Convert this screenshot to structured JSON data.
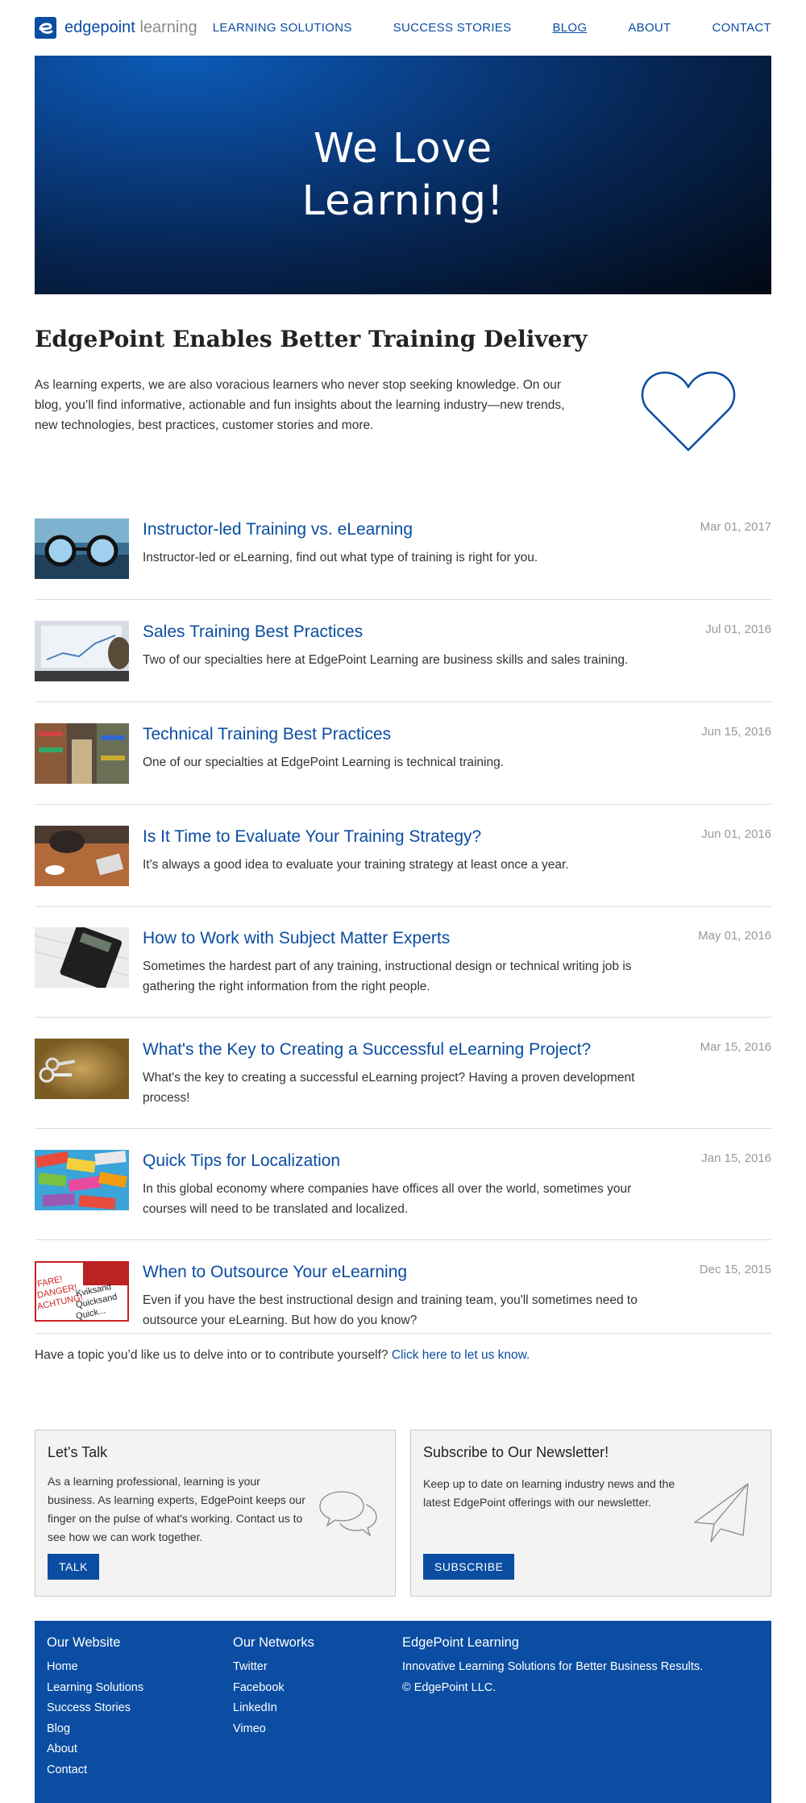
{
  "header": {
    "logo_brand": "edgepoint",
    "logo_suffix": "learning",
    "nav": [
      {
        "label": "LEARNING SOLUTIONS"
      },
      {
        "label": "SUCCESS STORIES"
      },
      {
        "label": "BLOG"
      },
      {
        "label": "ABOUT"
      },
      {
        "label": "CONTACT"
      }
    ]
  },
  "hero": {
    "title": "We Love\nLearning!"
  },
  "intro": {
    "heading": "EdgePoint Enables Better Training Delivery",
    "text": "As learning experts, we are also voracious learners who never stop seeking knowledge. On our blog, you’ll find informative, actionable and fun insights about the learning industry—new trends, new technologies, best practices, customer stories and more.",
    "icon": "heart-icon"
  },
  "posts": [
    {
      "title": "Instructor-led Training vs. eLearning",
      "desc": "Instructor-led or eLearning, find out what type of training is right for you.",
      "date": "Mar 01, 2017"
    },
    {
      "title": "Sales Training Best Practices",
      "desc": "Two of our specialties here at EdgePoint Learning are business skills and sales training.",
      "date": "Jul 01, 2016"
    },
    {
      "title": "Technical Training Best Practices",
      "desc": "One of our specialties at EdgePoint Learning is technical training.",
      "date": "Jun 15, 2016"
    },
    {
      "title": "Is It Time to Evaluate Your Training Strategy?",
      "desc": "It's always a good idea to evaluate your training strategy at least once a year.",
      "date": "Jun 01, 2016"
    },
    {
      "title": "How to Work with Subject Matter Experts",
      "desc": "Sometimes the hardest part of any training, instructional design or technical writing job is gathering the right information from the right people.",
      "date": "May 01, 2016"
    },
    {
      "title": "What's the Key to Creating a Successful eLearning Project?",
      "desc": "What's the key to creating a successful eLearning project? Having a proven development process!",
      "date": "Mar 15, 2016"
    },
    {
      "title": "Quick Tips for Localization",
      "desc": "In this global economy where companies have offices all over the world, sometimes your courses will need to be translated and localized.",
      "date": "Jan 15, 2016"
    },
    {
      "title": "When to Outsource Your eLearning",
      "desc": "Even if you have the best instructional design and training team, you'll sometimes need to outsource your eLearning. But how do you know?",
      "date": "Dec 15, 2015",
      "thumb_text": [
        "FARE!",
        "DANGER!",
        "ACHTUNG!",
        "Kviksand",
        "Quicksand",
        "Quick..."
      ]
    }
  ],
  "topic": {
    "text": "Have a topic you’d like us to delve into or to contribute yourself? ",
    "link": "Click here to let us know."
  },
  "talk_box": {
    "title": "Let's Talk",
    "text": "As a learning professional, learning is your business. As learning experts, EdgePoint keeps our finger on the pulse of what's working. Contact us to see how we can work together.",
    "button": "TALK",
    "icon": "chat-bubbles-icon"
  },
  "newsletter_box": {
    "title": "Subscribe to Our Newsletter!",
    "text": "Keep up to date on learning industry news and the latest EdgePoint offerings with our newsletter.",
    "button": "SUBSCRIBE",
    "icon": "paper-plane-icon"
  },
  "footer": {
    "website": {
      "heading": "Our Website",
      "links": [
        "Home",
        "Learning Solutions",
        "Success Stories",
        "Blog",
        "About",
        "Contact"
      ]
    },
    "networks": {
      "heading": "Our Networks",
      "links": [
        "Twitter",
        "Facebook",
        "LinkedIn",
        "Vimeo"
      ]
    },
    "company": {
      "heading": "EdgePoint Learning",
      "tagline": "Innovative Learning Solutions for Better Business Results.",
      "copyright": "© EdgePoint LLC."
    }
  },
  "colors": {
    "brand_blue": "#0a4da2",
    "date_gray": "#999999",
    "box_bg": "#f3f3f3"
  }
}
